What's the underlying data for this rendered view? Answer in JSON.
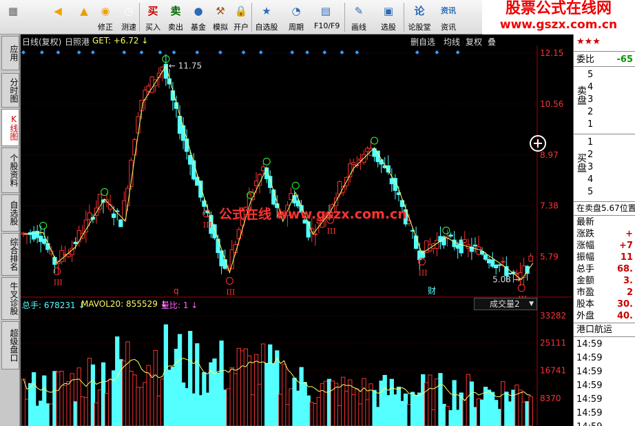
{
  "toolbar": {
    "buttons": [
      {
        "icon": "tiles-icon",
        "label": ""
      },
      {
        "icon": "back-arrow-icon",
        "label": ""
      },
      {
        "icon": "updown-icon",
        "label": ""
      },
      {
        "icon": "fix-icon",
        "label": "修正"
      },
      {
        "icon": "clock-icon",
        "label": "测速"
      },
      {
        "icon": "buy-icon",
        "label": "买入",
        "glyph": "买"
      },
      {
        "icon": "sell-icon",
        "label": "卖出",
        "glyph": "卖"
      },
      {
        "icon": "fund-icon",
        "label": "基金"
      },
      {
        "icon": "gavel-icon",
        "label": "模拟"
      },
      {
        "icon": "lock-icon",
        "label": "开户"
      },
      {
        "icon": "star-list-icon",
        "label": "自选股"
      },
      {
        "icon": "period-icon",
        "label": "周期"
      },
      {
        "icon": "f10-icon",
        "label": "F10/F9"
      },
      {
        "icon": "pen-icon",
        "label": "画线"
      },
      {
        "icon": "select-stock-icon",
        "label": "选股"
      },
      {
        "icon": "forum-icon",
        "label": "论股堂",
        "glyph": "论"
      },
      {
        "icon": "news-icon",
        "label": "资讯",
        "glyph": "资讯"
      }
    ],
    "brand_line1": "股票公式在线网",
    "brand_line2": "www.gszx.com.cn"
  },
  "left_tabs": [
    "应用",
    "分时图",
    "K线图",
    "个股资料",
    "自选股",
    "综合排名",
    "牛叉诊股",
    "超级盘口"
  ],
  "chart_header": {
    "mode": "日线(复权)",
    "stock_name": "日照港",
    "indicator": "GET: +6.72",
    "links": [
      "删自选",
      "均线",
      "复权",
      "叠"
    ]
  },
  "volume_header": {
    "total_label": "总手: 678231",
    "mavol": "MAVOL20: 855529",
    "ratio": "量比: 1",
    "selector": "成交量2"
  },
  "chart_data": {
    "type": "candlestick",
    "price_axis_ticks": [
      12.15,
      10.56,
      8.97,
      7.38,
      5.79
    ],
    "price_range": [
      4.6,
      12.3
    ],
    "annotations": {
      "high": "11.75",
      "low": "5.08",
      "watermark": "公式在线 www.gszx.com.cn"
    },
    "volume_axis_ticks": [
      33282,
      25111,
      16741,
      8370
    ],
    "volume_range": [
      0,
      35000
    ],
    "colors": {
      "up": "#ff3333",
      "down": "#54ffff",
      "zigzag": "#ffff66",
      "mavol": "#ffff66",
      "axis": "#aa0000",
      "volume_up": "#ff3333"
    },
    "zigzag": [
      [
        0,
        6.5
      ],
      [
        17,
        6.55
      ],
      [
        29,
        5.6
      ],
      [
        45,
        6.1
      ],
      [
        70,
        7.6
      ],
      [
        88,
        6.9
      ],
      [
        103,
        10.6
      ],
      [
        123,
        11.75
      ],
      [
        135,
        10.2
      ],
      [
        158,
        7.4
      ],
      [
        178,
        5.3
      ],
      [
        196,
        7.5
      ],
      [
        210,
        8.55
      ],
      [
        224,
        6.9
      ],
      [
        235,
        7.8
      ],
      [
        250,
        6.5
      ],
      [
        265,
        7.2
      ],
      [
        285,
        8.55
      ],
      [
        303,
        9.2
      ],
      [
        323,
        8.0
      ],
      [
        344,
        5.9
      ],
      [
        365,
        6.4
      ],
      [
        375,
        6.2
      ],
      [
        395,
        6.0
      ],
      [
        415,
        5.5
      ],
      [
        430,
        5.08
      ],
      [
        440,
        5.6
      ]
    ],
    "wave_labels_green": [
      [
        17,
        6.55
      ],
      [
        70,
        7.6
      ],
      [
        123,
        11.75
      ],
      [
        196,
        7.5
      ],
      [
        210,
        8.55
      ],
      [
        235,
        7.8
      ],
      [
        303,
        9.2
      ],
      [
        365,
        6.4
      ]
    ],
    "wave_labels_red_bottom": [
      [
        29,
        5.6
      ],
      [
        158,
        7.4
      ],
      [
        178,
        5.3
      ],
      [
        265,
        7.2
      ],
      [
        344,
        5.9
      ],
      [
        430,
        5.08
      ]
    ],
    "markers_top": [
      0,
      16,
      30,
      48,
      60,
      87,
      102,
      118,
      130,
      150,
      170,
      190,
      205,
      232,
      245,
      260,
      275,
      288,
      340,
      357,
      375
    ]
  },
  "right_panel": {
    "stars": "★★★",
    "ratio_label": "委比",
    "ratio_value": "-65",
    "sell_label": "卖盘",
    "buy_label": "买盘",
    "sell_levels": [
      "5",
      "4",
      "3",
      "2",
      "1"
    ],
    "buy_levels": [
      "1",
      "2",
      "3",
      "4",
      "5"
    ],
    "in_sale": "在卖盘5.67位置",
    "stats": [
      {
        "k": "最新",
        "v": ""
      },
      {
        "k": "涨跌",
        "v": "+"
      },
      {
        "k": "涨幅",
        "v": "+7"
      },
      {
        "k": "振幅",
        "v": "11"
      },
      {
        "k": "总手",
        "v": "68."
      },
      {
        "k": "金额",
        "v": "3."
      },
      {
        "k": "市盈",
        "v": "2"
      },
      {
        "k": "股本",
        "v": "30."
      },
      {
        "k": "外盘",
        "v": "40."
      }
    ],
    "ticker": "港口航运",
    "times": [
      "14:59",
      "14:59",
      "14:59",
      "14:59",
      "14:59",
      "14:59",
      "14:59"
    ]
  },
  "chart_labels": {
    "q_marker": "q",
    "cai_marker": "财"
  }
}
